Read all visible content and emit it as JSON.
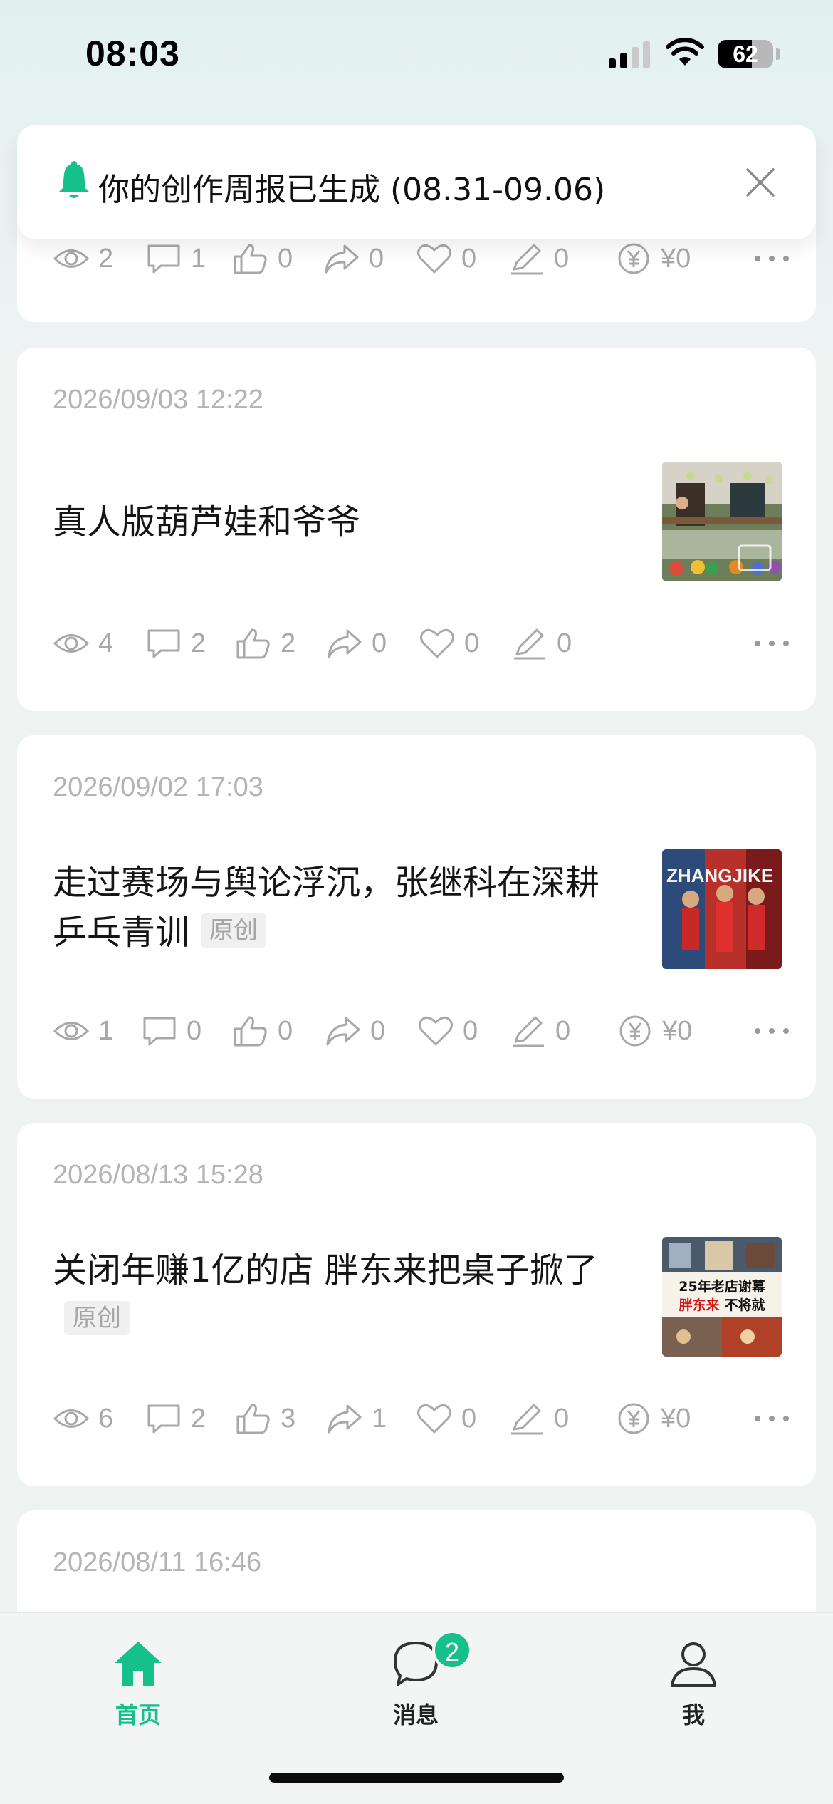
{
  "status_bar": {
    "time": "08:03",
    "battery": "62",
    "battery_level": 0.62
  },
  "notification": {
    "text": "你的创作周报已生成 (08.31-09.06)",
    "icon": "bell-icon",
    "accent": "#16c08a"
  },
  "posts": [
    {
      "date": "",
      "title": "",
      "stats": {
        "views": "2",
        "comments": "1",
        "likes": "0",
        "shares": "0",
        "favorites": "0",
        "edits": "0",
        "earnings": "¥0"
      }
    },
    {
      "date": "2026/09/03 12:22",
      "title": "真人版葫芦娃和爷爷",
      "tag": "",
      "stats": {
        "views": "4",
        "comments": "2",
        "likes": "2",
        "shares": "0",
        "favorites": "0",
        "edits": "0"
      }
    },
    {
      "date": "2026/09/02 17:03",
      "title": "走过赛场与舆论浮沉，张继科在深耕乒乓青训",
      "tag": "原创",
      "stats": {
        "views": "1",
        "comments": "0",
        "likes": "0",
        "shares": "0",
        "favorites": "0",
        "edits": "0",
        "earnings": "¥0"
      },
      "thumb_text": "ZHANGJIKE"
    },
    {
      "date": "2026/08/13 15:28",
      "title": "关闭年赚1亿的店 胖东来把桌子掀了",
      "tag": "原创",
      "stats": {
        "views": "6",
        "comments": "2",
        "likes": "3",
        "shares": "1",
        "favorites": "0",
        "edits": "0",
        "earnings": "¥0"
      },
      "thumb_line1": "25年老店谢幕",
      "thumb_line2_red": "胖东来",
      "thumb_line2_black": "不将就"
    },
    {
      "date": "2026/08/11 16:46"
    }
  ],
  "tabbar": {
    "home": "首页",
    "messages": "消息",
    "messages_badge": "2",
    "me": "我"
  },
  "colors": {
    "accent": "#16c08a",
    "meta_gray": "#a8a8a8"
  }
}
